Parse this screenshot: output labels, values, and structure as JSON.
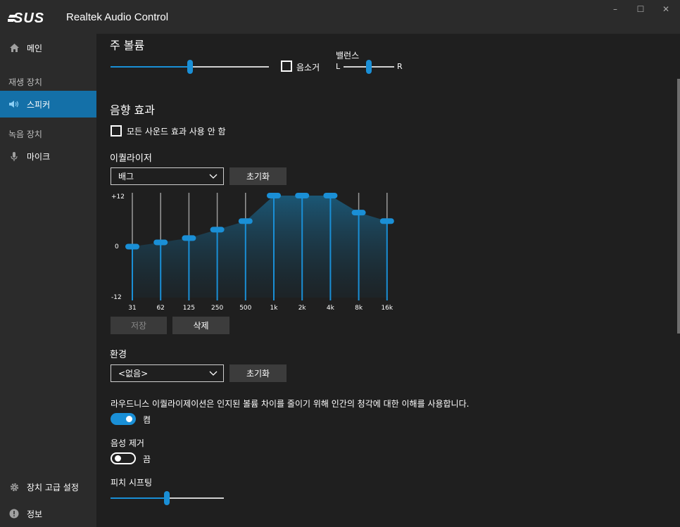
{
  "window": {
    "title": "Realtek Audio Control",
    "brand": "ASUS",
    "controls": {
      "minimize": "–",
      "maximize": "☐",
      "close": "✕"
    }
  },
  "sidebar": {
    "main_label": "메인",
    "section_playback": "재생 장치",
    "speaker_label": "스피커",
    "section_record": "녹음 장치",
    "mic_label": "마이크",
    "advanced_label": "장치 고급 설정",
    "info_label": "정보",
    "icons": {
      "main": "home-icon",
      "speaker": "speaker-icon",
      "mic": "microphone-icon",
      "advanced": "gear-icon",
      "info": "info-icon"
    }
  },
  "main_volume": {
    "title": "주 볼륨",
    "volume_percent": 50,
    "mute_label": "음소거",
    "mute_checked": false,
    "balance_label": "밸런스",
    "balance_left": "L",
    "balance_right": "R",
    "balance_percent": 50
  },
  "effects": {
    "title": "음향 효과",
    "disable_all_label": "모든 사운드 효과 사용 안 함",
    "disable_all_checked": false
  },
  "equalizer": {
    "title": "이퀄라이저",
    "preset": "배그",
    "reset_label": "초기화",
    "save_label": "저장",
    "delete_label": "삭제",
    "scale_max": "+12",
    "scale_mid": "0",
    "scale_min": "-12",
    "range": [
      -12,
      12
    ]
  },
  "chart_data": {
    "type": "area",
    "categories": [
      "31",
      "62",
      "125",
      "250",
      "500",
      "1k",
      "2k",
      "4k",
      "8k",
      "16k"
    ],
    "values": [
      0,
      1,
      2,
      4,
      6,
      12,
      12,
      12,
      8,
      6
    ],
    "ylim": [
      -12,
      12
    ]
  },
  "environment": {
    "title": "환경",
    "value": "<없음>",
    "reset_label": "초기화"
  },
  "loudness": {
    "description": "라우드니스 이퀄라이제이션은 인지된 볼륨 차이를 줄이기 위해 인간의 청각에 대한 이해를 사용합니다.",
    "state_label": "켬",
    "on": true
  },
  "voice_cancel": {
    "title": "음성 제거",
    "state_label": "끔",
    "on": false
  },
  "pitch": {
    "title": "피치 시프팅",
    "value_percent": 50
  },
  "colors": {
    "accent": "#1a8fd6",
    "sidebar_active": "#1470a8",
    "background": "#1f1f1f",
    "panel": "#2b2b2b"
  }
}
